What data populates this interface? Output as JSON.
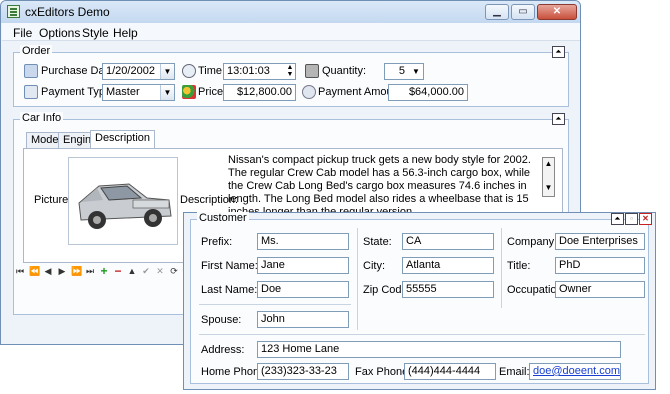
{
  "window": {
    "title": "cxEditors Demo"
  },
  "menu": [
    "File",
    "Options",
    "Style",
    "Help"
  ],
  "order": {
    "title": "Order",
    "purchase_date_label": "Purchase Date:",
    "purchase_date": "1/20/2002",
    "time_label": "Time:",
    "time": "13:01:03",
    "quantity_label": "Quantity:",
    "quantity": "5",
    "payment_type_label": "Payment Type:",
    "payment_type": "Master",
    "price_label": "Price:",
    "price": "$12,800.00",
    "payment_amount_label": "Payment Amount:",
    "payment_amount": "$64,000.00"
  },
  "car_info": {
    "title": "Car Info",
    "tabs": [
      "Model",
      "Engine",
      "Description"
    ],
    "active_tab": "Description",
    "picture_label": "Picture:",
    "description_label": "Description:",
    "description": "Nissan's compact pickup truck gets a new body style for 2002. The regular Crew Cab model has a 56.3-inch cargo box, while the Crew Cab Long Bed's cargo box measures 74.6 inches in length. The Long Bed model also rides a wheelbase that is 15 inches longer than the regular version."
  },
  "navigator": [
    "⏮",
    "⏪",
    "◀",
    "▶",
    "⏩",
    "⏭",
    "+",
    "−",
    "▲",
    "✔",
    "✕",
    "⟳",
    "✱"
  ],
  "customer": {
    "title": "Customer",
    "prefix_label": "Prefix:",
    "prefix": "Ms.",
    "first_name_label": "First Name:",
    "first_name": "Jane",
    "last_name_label": "Last Name:",
    "last_name": "Doe",
    "spouse_label": "Spouse:",
    "spouse": "John",
    "state_label": "State:",
    "state": "CA",
    "city_label": "City:",
    "city": "Atlanta",
    "zip_label": "Zip Code:",
    "zip": "55555",
    "company_label": "Company:",
    "company": "Doe Enterprises",
    "title_label": "Title:",
    "title_value": "PhD",
    "occupation_label": "Occupation:",
    "occupation": "Owner",
    "address_label": "Address:",
    "address": "123 Home Lane",
    "home_phone_label": "Home Phone:",
    "home_phone": "(233)323-33-23",
    "fax_phone_label": "Fax Phone:",
    "fax_phone": "(444)444-4444",
    "email_label": "Email:",
    "email": "doe@doeent.com"
  },
  "colors": {
    "accent": "#6f8fb4",
    "link": "#1a3fd0",
    "close": "#c8503c"
  }
}
